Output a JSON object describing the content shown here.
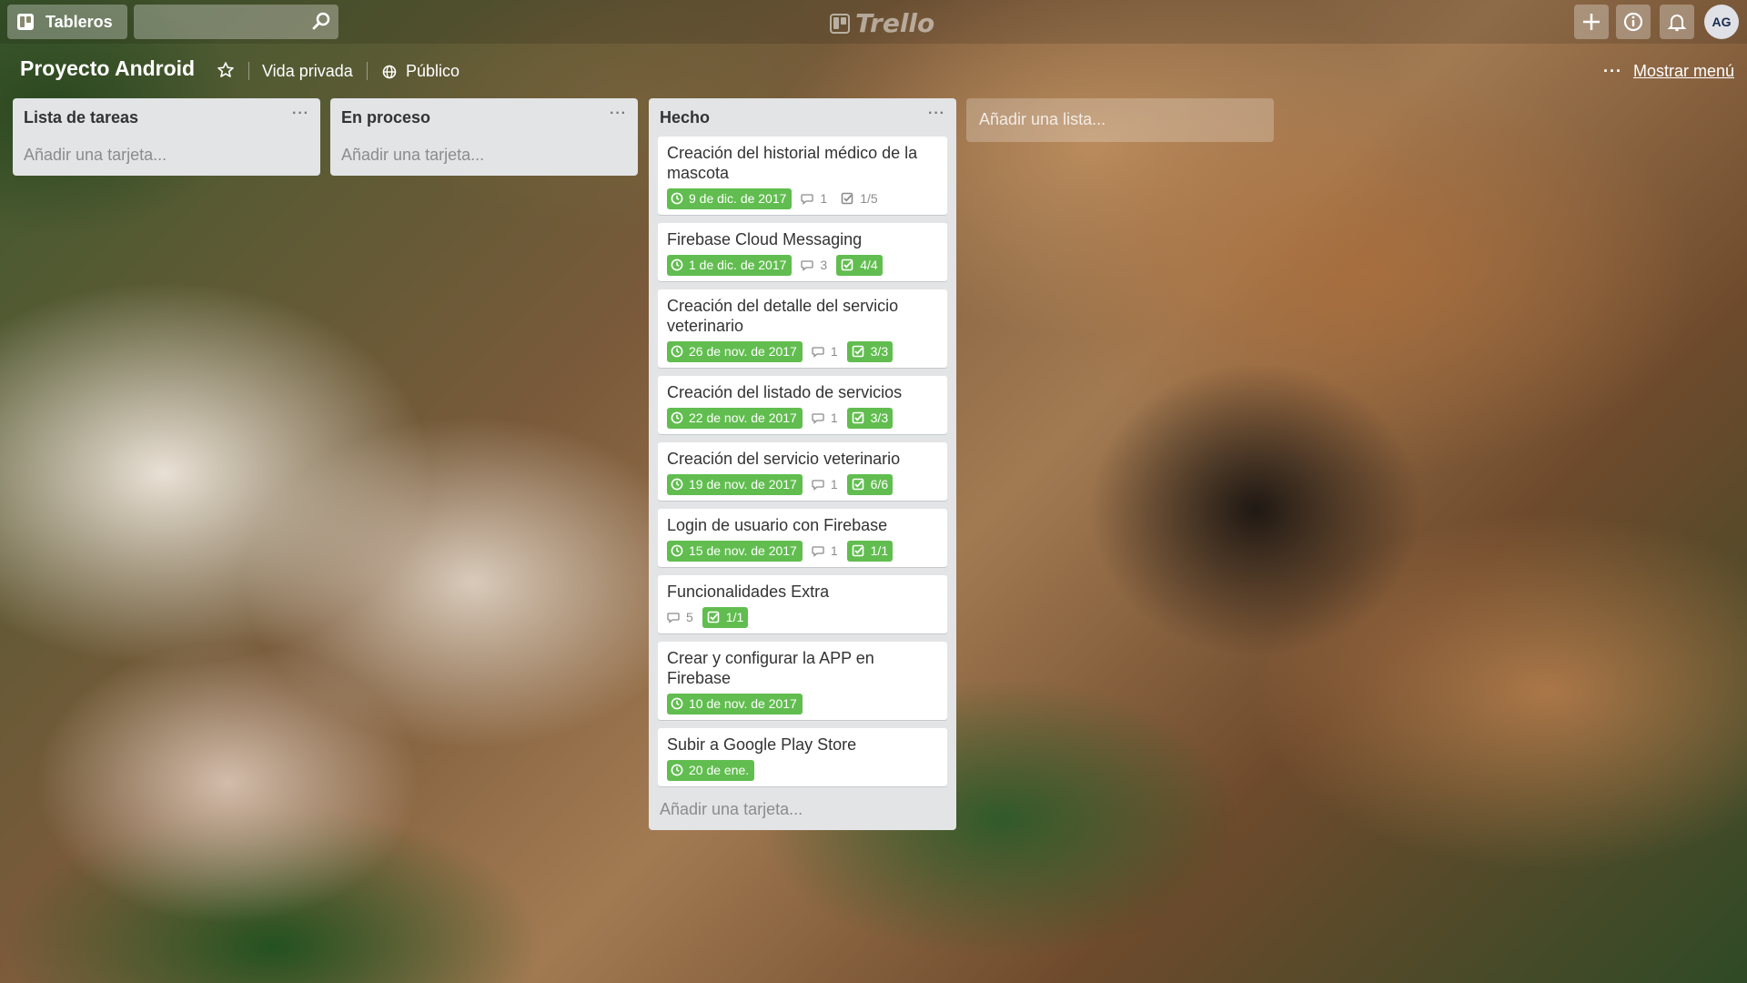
{
  "header": {
    "boards_label": "Tableros",
    "search_placeholder": "",
    "logo_text": "Trello",
    "avatar_initials": "AG"
  },
  "board": {
    "title": "Proyecto Android",
    "privacy": "Vida privada",
    "visibility": "Público",
    "menu_dots": "···",
    "show_menu": "Mostrar menú"
  },
  "lists": [
    {
      "title": "Lista de tareas",
      "menu": "···",
      "add_card": "Añadir una tarjeta..."
    },
    {
      "title": "En proceso",
      "menu": "···",
      "add_card": "Añadir una tarjeta..."
    },
    {
      "title": "Hecho",
      "menu": "···",
      "add_card": "Añadir una tarjeta...",
      "cards": [
        {
          "title": "Creación del historial médico de la mascota",
          "due": "9 de dic. de 2017",
          "comments": "1",
          "checklist": "1/5",
          "checklist_done": false
        },
        {
          "title": "Firebase Cloud Messaging",
          "due": "1 de dic. de 2017",
          "comments": "3",
          "checklist": "4/4",
          "checklist_done": true
        },
        {
          "title": "Creación del detalle del servicio veterinario",
          "due": "26 de nov. de 2017",
          "comments": "1",
          "checklist": "3/3",
          "checklist_done": true
        },
        {
          "title": "Creación del listado de servicios",
          "due": "22 de nov. de 2017",
          "comments": "1",
          "checklist": "3/3",
          "checklist_done": true
        },
        {
          "title": "Creación del servicio veterinario",
          "due": "19 de nov. de 2017",
          "comments": "1",
          "checklist": "6/6",
          "checklist_done": true
        },
        {
          "title": "Login de usuario con Firebase",
          "due": "15 de nov. de 2017",
          "comments": "1",
          "checklist": "1/1",
          "checklist_done": true
        },
        {
          "title": "Funcionalidades Extra",
          "due": "",
          "comments": "5",
          "checklist": "1/1",
          "checklist_done": true
        },
        {
          "title": "Crear y configurar la APP en Firebase",
          "due": "10 de nov. de 2017",
          "comments": "",
          "checklist": "",
          "checklist_done": false
        },
        {
          "title": "Subir a Google Play Store",
          "due": "20 de ene.",
          "comments": "",
          "checklist": "",
          "checklist_done": false
        }
      ]
    }
  ],
  "add_list": "Añadir una lista...",
  "colors": {
    "due_green": "#61bd4f",
    "list_bg": "#e2e4e6"
  }
}
